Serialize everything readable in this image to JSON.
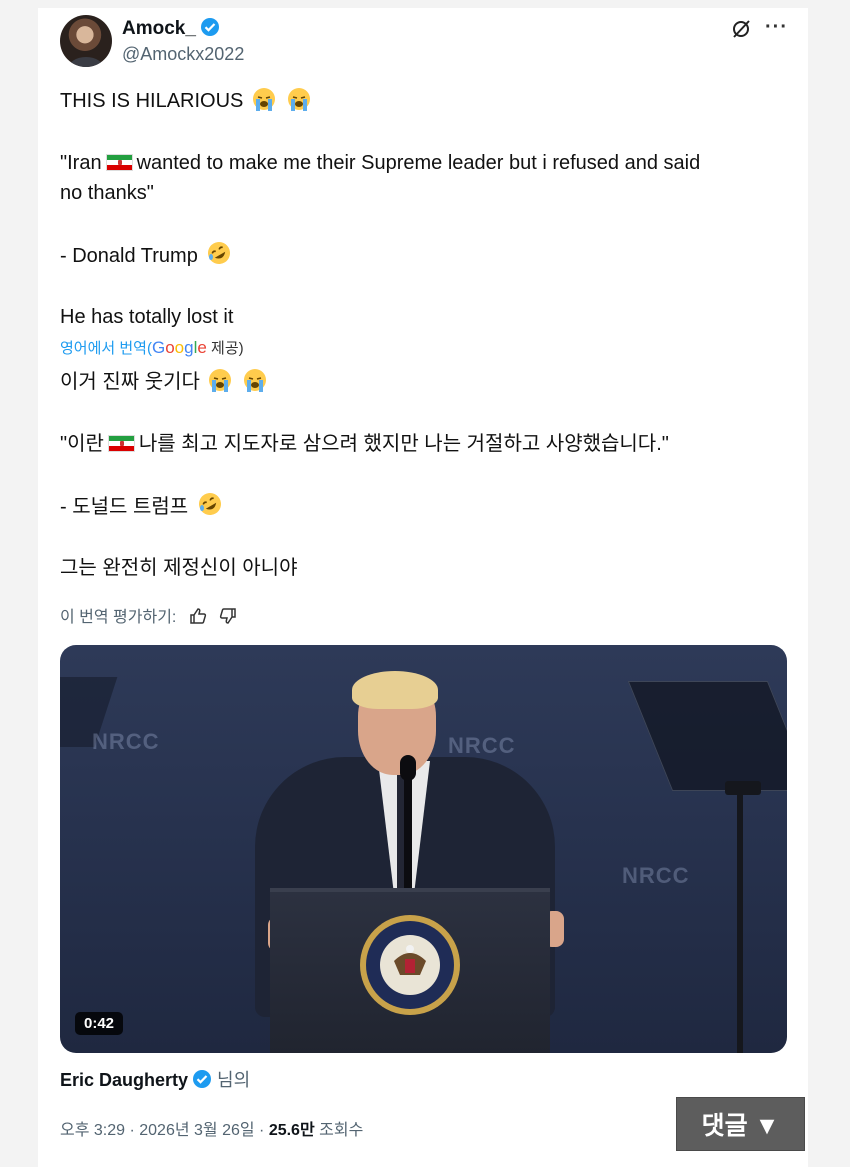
{
  "author": {
    "name": "Amock_",
    "handle": "@Amockx2022"
  },
  "tweet": {
    "line1": "THIS IS HILARIOUS",
    "quote_part1": "\"Iran",
    "quote_part2": "wanted to make me their Supreme leader but i refused and said",
    "quote_part3": "no thanks\"",
    "attribution": "- Donald Trump",
    "closing": "He has totally lost it"
  },
  "translation": {
    "label_prefix": "영어에서 번역(",
    "provider": "Google",
    "label_suffix": "제공)",
    "line1": "이거 진짜 웃기다",
    "quote_part1": "\"이란",
    "quote_part2": "나를 최고 지도자로 삼으려 했지만 나는 거절하고 사양했습니다.\"",
    "attribution": "- 도널드 트럼프",
    "closing": "그는 완전히 제정신이 아니야",
    "rate_label": "이 번역 평가하기:"
  },
  "video": {
    "duration": "0:42",
    "watermark": "NRCC"
  },
  "credit": {
    "name": "Eric Daugherty",
    "suffix": "님의"
  },
  "meta": {
    "time": "오후 3:29 · 2026년 3월 26일 · ",
    "views": "25.6만",
    "views_label": " 조회수"
  },
  "overlay": {
    "comment_button": "댓글 ▼"
  },
  "colors": {
    "verified": "#1d9bf0",
    "link": "#1d9bf0",
    "muted": "#536471"
  }
}
